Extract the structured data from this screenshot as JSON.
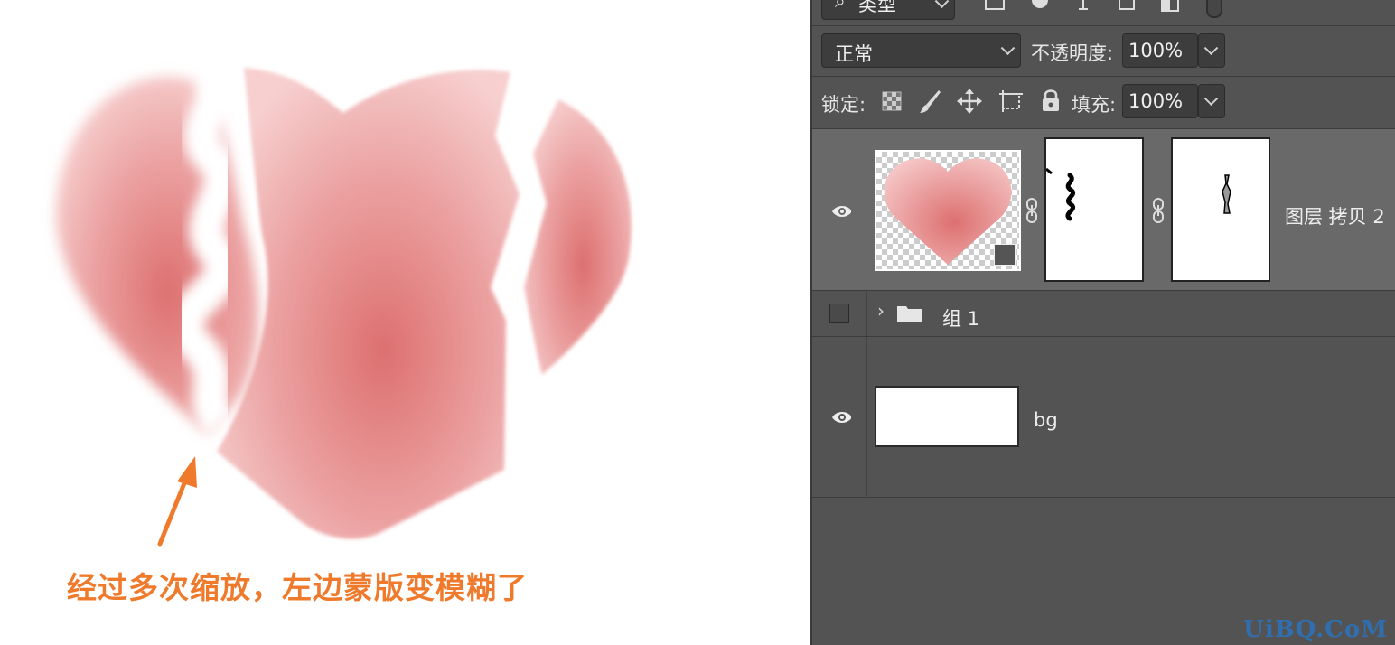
{
  "canvas": {
    "caption": "经过多次缩放，左边蒙版变模糊了",
    "heart_color": "#e27878",
    "arrow_color": "#f07a2c"
  },
  "panel": {
    "filter_label": "类型",
    "blend_mode": "正常",
    "opacity_label": "不透明度:",
    "opacity_value": "100%",
    "lock_label": "锁定:",
    "fill_label": "填充:",
    "fill_value": "100%",
    "layers": [
      {
        "name": "图层 拷贝 2",
        "visible": true,
        "selected": true
      },
      {
        "name": "组 1",
        "visible": false,
        "type": "group"
      },
      {
        "name": "bg",
        "visible": true
      }
    ]
  },
  "watermark": "UiBQ.CoM"
}
